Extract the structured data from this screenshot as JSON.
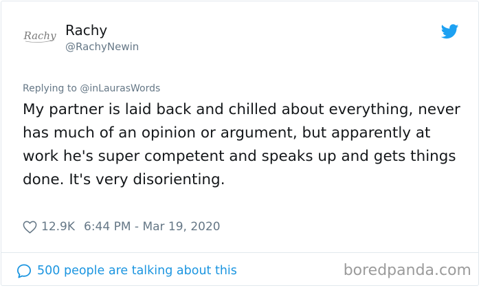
{
  "author": {
    "name": "Rachy",
    "handle": "@RachyNewin",
    "avatar_signature": "Rachy"
  },
  "tweet": {
    "replying_to": "Replying to @inLaurasWords",
    "text": "My partner is laid back and chilled about everything, never has much of an opinion or argument, but apparently at work he's super competent and speaks up and gets things done. It's very disorienting.",
    "likes": "12.9K",
    "timestamp": "6:44 PM - Mar 19, 2020"
  },
  "footer": {
    "talking_text": "500 people are talking about this",
    "watermark": "boredpanda.com"
  },
  "colors": {
    "twitter_blue": "#1da1f2",
    "link_blue": "#1b95e0",
    "text": "#14171a",
    "secondary": "#657786",
    "border": "#e1e8ed",
    "watermark": "#9b9b9b"
  },
  "icons": {
    "brand": "twitter-bird-icon",
    "like": "heart-outline-icon",
    "conversation": "speech-bubble-icon"
  }
}
